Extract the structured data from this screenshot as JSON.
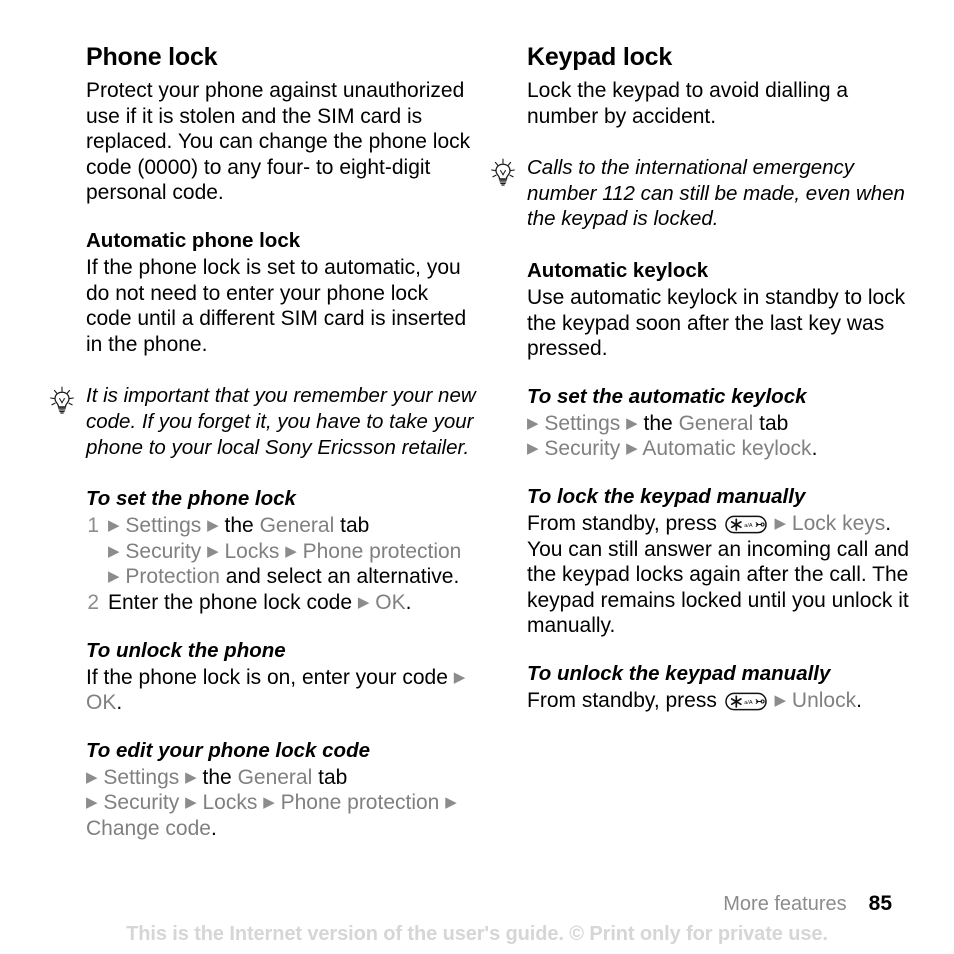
{
  "page": {
    "number": "85",
    "running_head": "More features",
    "disclaimer": "This is the Internet version of the user's guide. © Print only for private use."
  },
  "left_column": {
    "section_title": "Phone lock",
    "intro": "Protect your phone against unauthorized use if it is stolen and the SIM card is replaced. You can change the phone lock code (0000) to any four- to eight-digit personal code.",
    "subsection_title": "Automatic phone lock",
    "subsection_body": "If the phone lock is set to automatic, you do not need to enter your phone lock code until a different SIM card is inserted in the phone.",
    "tip": {
      "icon": "lightbulb-icon",
      "text": "It is important that you remember your new code. If you forget it, you have to take your phone to your local Sony Ericsson retailer."
    },
    "procedure_set_phone_lock": {
      "title": "To set the phone lock",
      "step1": {
        "number": "1",
        "p1_menu1": "Settings",
        "p1_the": "the",
        "p1_menu2": "General",
        "p1_tab": "tab",
        "p2_menu1": "Security",
        "p2_menu2": "Locks",
        "p2_menu3": "Phone protection",
        "p2_menu4": "Protection",
        "p2_tail": "and select an alternative."
      },
      "step2": {
        "number": "2",
        "text": "Enter the phone lock code",
        "menu": "OK",
        "period": "."
      }
    },
    "procedure_unlock_phone": {
      "title": "To unlock the phone",
      "body_lead": "If the phone lock is on, enter your code",
      "menu": "OK",
      "period": "."
    },
    "procedure_edit_code": {
      "title": "To edit your phone lock code",
      "p1_menu1": "Settings",
      "p1_the": "the",
      "p1_menu2": "General",
      "p1_tab": "tab",
      "p2_menu1": "Security",
      "p2_menu2": "Locks",
      "p2_menu3": "Phone protection",
      "p2_menu4": "Change code",
      "period": "."
    }
  },
  "right_column": {
    "section_title": "Keypad lock",
    "intro": "Lock the keypad to avoid dialling a number by accident.",
    "tip": {
      "icon": "lightbulb-icon",
      "text": "Calls to the international emergency number 112 can still be made, even when the keypad is locked."
    },
    "subsection_title": "Automatic keylock",
    "subsection_body": "Use automatic keylock in standby to lock the keypad soon after the last key was pressed.",
    "procedure_set_auto_keylock": {
      "title": "To set the automatic keylock",
      "p1_menu1": "Settings",
      "p1_the": "the",
      "p1_menu2": "General",
      "p1_tab": "tab",
      "p2_menu1": "Security",
      "p2_menu2": "Automatic keylock",
      "period": "."
    },
    "procedure_lock_manually": {
      "title": "To lock the keypad manually",
      "lead": "From standby, press",
      "key_icon": "star-key-icon",
      "menu": "Lock keys",
      "tail": ". You can still answer an incoming call and the keypad locks again after the call. The keypad remains locked until you unlock it manually."
    },
    "procedure_unlock_manually": {
      "title": "To unlock the keypad manually",
      "lead": "From standby, press",
      "key_icon": "star-key-icon",
      "menu": "Unlock",
      "period": "."
    }
  },
  "colors": {
    "menu_gray": "#808080",
    "marker_gray": "#8c8c8c",
    "disclaimer_gray": "#d6d6d6",
    "text_black": "#000000"
  }
}
